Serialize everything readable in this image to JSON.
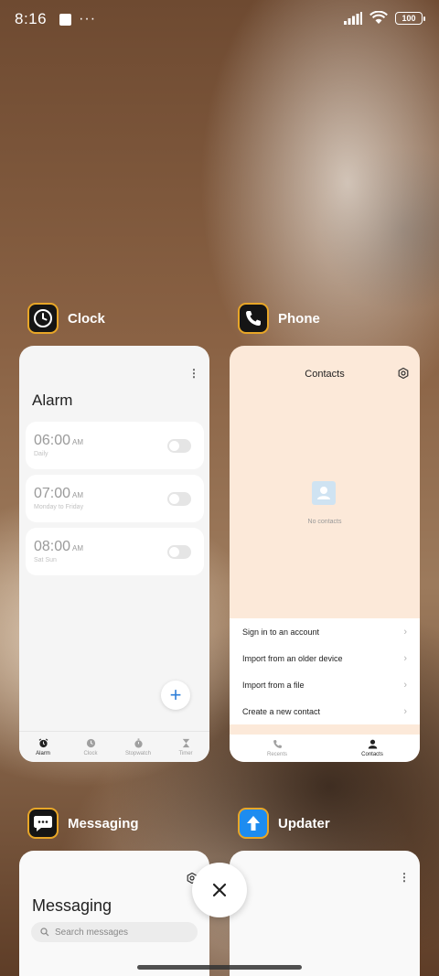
{
  "status_bar": {
    "time": "8:16",
    "more": "···",
    "battery": "100",
    "icons": [
      "notification-square-icon",
      "more-dots-icon",
      "signal-icon",
      "wifi-icon",
      "battery-icon"
    ]
  },
  "recents": [
    {
      "app": "Clock",
      "icon": "clock-icon",
      "preview": {
        "title": "Alarm",
        "alarms": [
          {
            "time": "06:00",
            "ampm": "AM",
            "repeat": "Daily",
            "enabled": false
          },
          {
            "time": "07:00",
            "ampm": "AM",
            "repeat": "Monday to Friday",
            "enabled": false
          },
          {
            "time": "08:00",
            "ampm": "AM",
            "repeat": "Sat Sun",
            "enabled": false
          }
        ],
        "fab": "+",
        "nav": [
          {
            "label": "Alarm",
            "icon": "alarm-icon",
            "active": true
          },
          {
            "label": "Clock",
            "icon": "clock-icon",
            "active": false
          },
          {
            "label": "Stopwatch",
            "icon": "stopwatch-icon",
            "active": false
          },
          {
            "label": "Timer",
            "icon": "hourglass-icon",
            "active": false
          }
        ]
      }
    },
    {
      "app": "Phone",
      "icon": "phone-icon",
      "preview": {
        "title": "Contacts",
        "empty_text": "No contacts",
        "actions": [
          "Sign in to an account",
          "Import from an older device",
          "Import from a file",
          "Create a new contact"
        ],
        "nav": [
          {
            "label": "Recents",
            "icon": "phone-icon",
            "active": false
          },
          {
            "label": "Contacts",
            "icon": "person-icon",
            "active": true
          }
        ]
      }
    },
    {
      "app": "Messaging",
      "icon": "chat-bubble-icon",
      "preview": {
        "title": "Messaging",
        "search_placeholder": "Search messages"
      }
    },
    {
      "app": "Updater",
      "icon": "update-arrow-icon"
    }
  ],
  "close_all": "close-icon",
  "colors": {
    "icon_border": "#e8a627",
    "phone_bg": "#fce9d9",
    "accent_blue": "#2e7fd8"
  }
}
